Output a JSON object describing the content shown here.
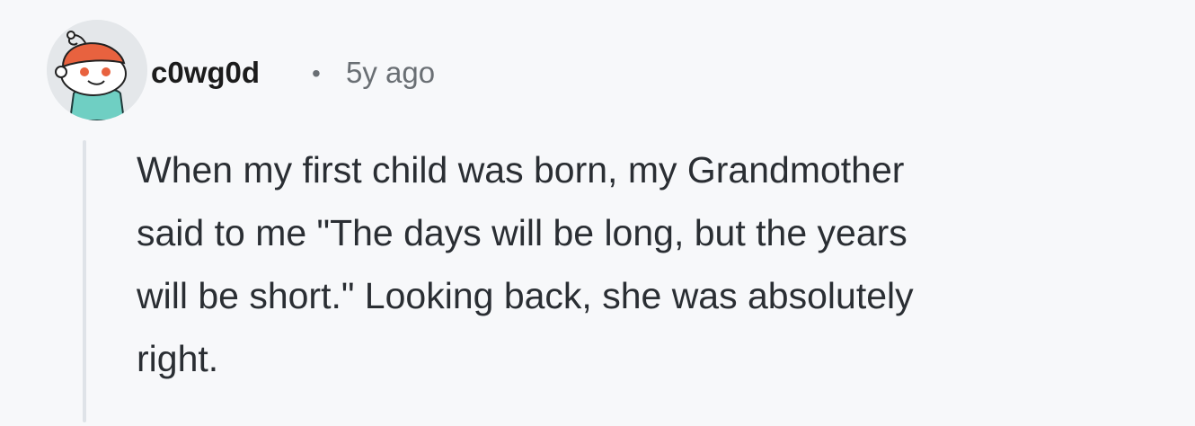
{
  "comment": {
    "author": {
      "username": "c0wg0d",
      "avatar_icon": "snoo-avatar-icon"
    },
    "separator": "•",
    "timestamp": "5y ago",
    "body_lines": [
      "When my first child was born, my Grandmother",
      "said to me \"The days will be long, but the years",
      "will be short.\" Looking back, she was absolutely",
      "right."
    ]
  },
  "colors": {
    "background": "#f7f8fa",
    "username": "#1c1c1c",
    "meta": "#6a6f74",
    "body_text": "#2a2e33",
    "thread_line": "#dfe3e8",
    "avatar_bg": "#e4e7ea",
    "avatar_hair": "#e8623f",
    "avatar_shirt": "#6fcfc3"
  }
}
